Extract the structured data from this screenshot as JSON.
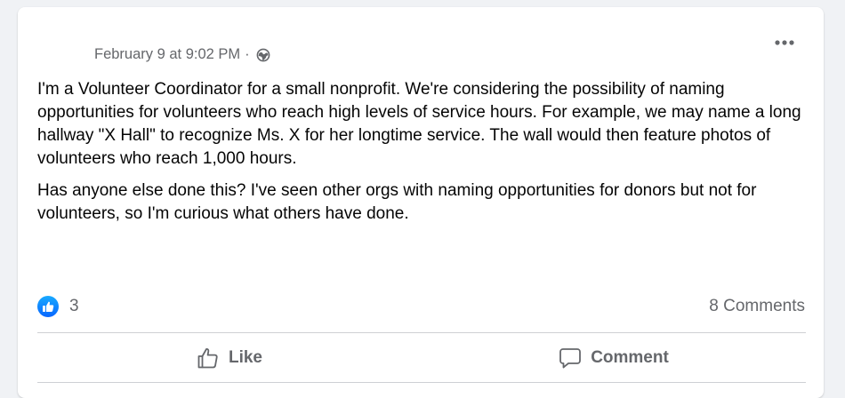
{
  "post": {
    "timestamp": "February 9 at 9:02 PM",
    "separator": "·",
    "audience_icon": "globe-icon",
    "more_icon": "more-options-icon",
    "paragraphs": [
      "I'm a Volunteer Coordinator for a small nonprofit.  We're considering the possibility of naming opportunities for volunteers who reach high levels of service hours.  For example, we may name a long hallway \"X Hall\" to recognize Ms. X for her longtime service.  The wall would then feature photos of volunteers who reach 1,000 hours.",
      "Has anyone else done this?  I've seen other orgs with naming opportunities for donors but not for volunteers, so I'm curious what others have done."
    ]
  },
  "stats": {
    "reaction_count": "3",
    "comments_label": "8 Comments"
  },
  "actions": {
    "like_label": "Like",
    "comment_label": "Comment"
  },
  "colors": {
    "background": "#f0f2f5",
    "card": "#ffffff",
    "text_primary": "#050505",
    "text_secondary": "#65676b",
    "like_blue": "#0866ff",
    "divider": "#ced0d4"
  }
}
